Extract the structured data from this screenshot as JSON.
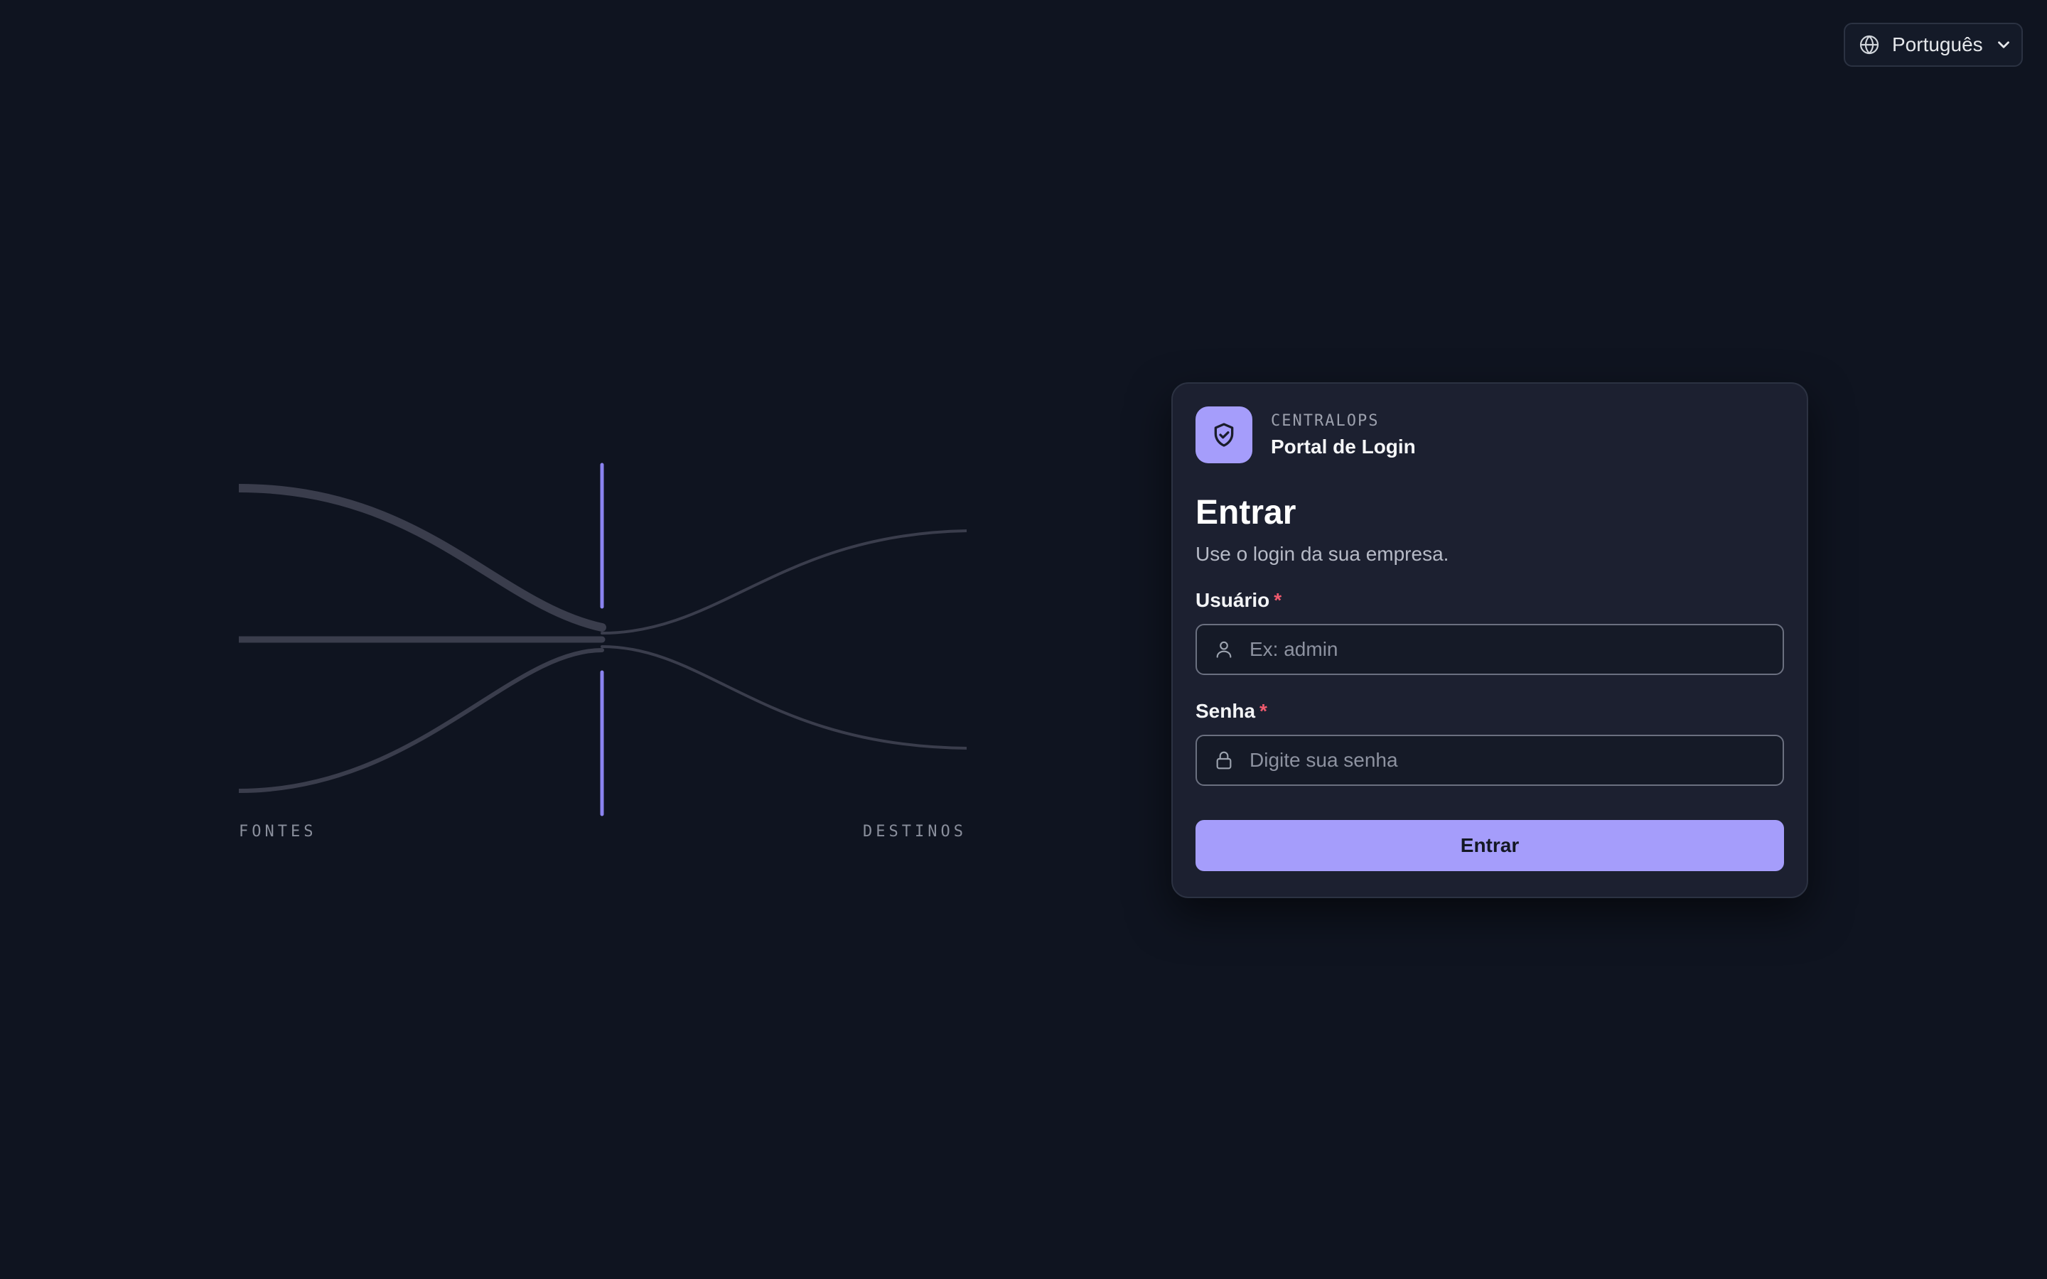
{
  "language": {
    "selected": "Português",
    "icon": "globe-icon",
    "chevron_icon": "chevron-down-icon"
  },
  "illustration": {
    "sources_label": "FONTES",
    "destinations_label": "DESTINOS",
    "accent_color": "#8b83f0",
    "line_color": "#3a3d4c"
  },
  "card": {
    "brand_name": "CENTRALOPS",
    "portal_title": "Portal de Login",
    "logo_icon": "shield-check-icon",
    "title": "Entrar",
    "subtitle": "Use o login da sua empresa.",
    "username": {
      "label": "Usuário",
      "required_mark": "*",
      "placeholder": "Ex: admin",
      "value": "",
      "icon": "user-icon"
    },
    "password": {
      "label": "Senha",
      "required_mark": "*",
      "placeholder": "Digite sua senha",
      "value": "",
      "icon": "lock-icon"
    },
    "submit_label": "Entrar"
  },
  "colors": {
    "background": "#0f1420",
    "card_background": "#1c2030",
    "accent": "#a59dfb",
    "required": "#f05a6e"
  }
}
